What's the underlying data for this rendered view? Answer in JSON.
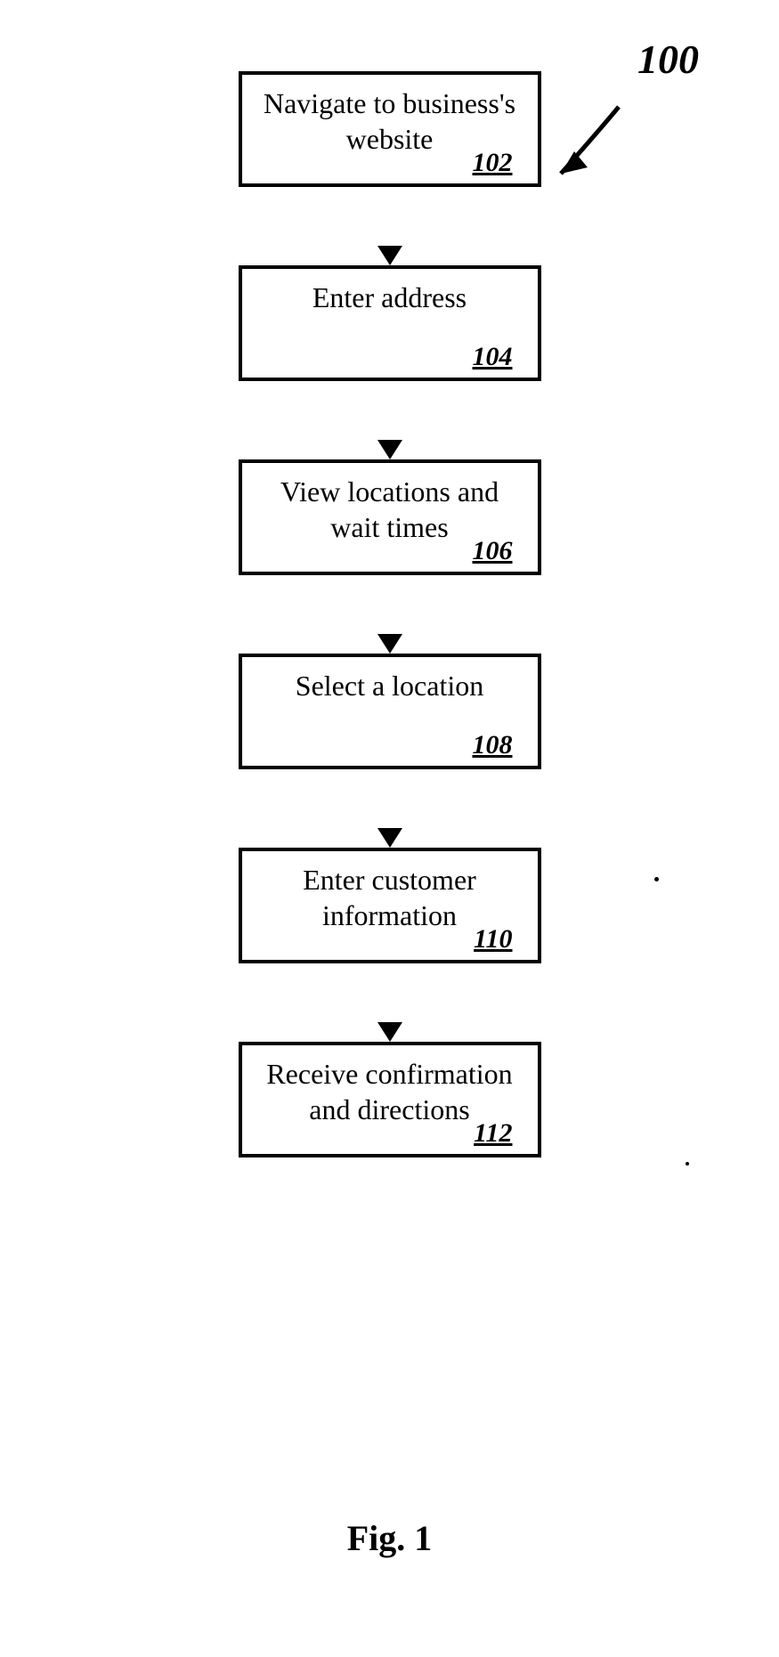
{
  "refLabel": "100",
  "steps": [
    {
      "text": "Navigate to business's website",
      "num": "102"
    },
    {
      "text": "Enter address",
      "num": "104"
    },
    {
      "text": "View locations and wait times",
      "num": "106"
    },
    {
      "text": "Select a location",
      "num": "108"
    },
    {
      "text": "Enter customer information",
      "num": "110"
    },
    {
      "text": "Receive confirmation and directions",
      "num": "112"
    }
  ],
  "caption": "Fig. 1"
}
